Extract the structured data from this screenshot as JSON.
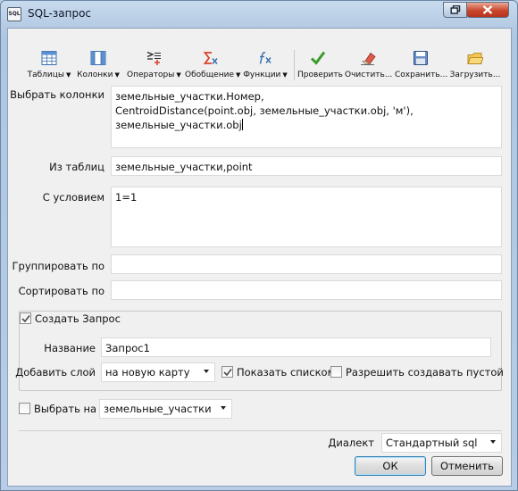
{
  "window": {
    "title": "SQL-запрос",
    "app_icon_text": "SQL"
  },
  "toolbar": {
    "buttons": [
      {
        "label": "Таблицы",
        "arrow": "▼",
        "icon": "table-icon"
      },
      {
        "label": "Колонки",
        "arrow": "▼",
        "icon": "columns-icon"
      },
      {
        "label": "Операторы",
        "arrow": "▼",
        "icon": "operators-icon"
      },
      {
        "label": "Обобщение",
        "arrow": "▼",
        "icon": "sigma-icon"
      },
      {
        "label": "Функции",
        "arrow": "▼",
        "icon": "function-icon"
      },
      {
        "label": "Проверить",
        "arrow": "",
        "icon": "check-icon"
      },
      {
        "label": "Очистить...",
        "arrow": "",
        "icon": "eraser-icon"
      },
      {
        "label": "Сохранить...",
        "arrow": "",
        "icon": "save-icon"
      },
      {
        "label": "Загрузить...",
        "arrow": "",
        "icon": "load-icon"
      }
    ]
  },
  "form": {
    "select_label": "Выбрать колонки",
    "select_lines": [
      "земельные_участки.Номер,",
      "CentroidDistance(point.obj, земельные_участки.obj, 'м'),",
      "земельные_участки.obj"
    ],
    "from_label": "Из таблиц",
    "from_value": "земельные_участки,point",
    "where_label": "С условием",
    "where_value": "1=1",
    "group_label": "Группировать по",
    "group_value": "",
    "order_label": "Сортировать по",
    "order_value": ""
  },
  "create_query": {
    "checkbox_label": "Создать Запрос",
    "checked": true,
    "name_label": "Название",
    "name_value": "Запрос1",
    "add_layer_label": "Добавить слой",
    "add_layer_value": "на новую карту",
    "show_list_label": "Показать списком",
    "show_list_checked": true,
    "allow_empty_label": "Разрешить создавать пустой",
    "allow_empty_checked": false
  },
  "select_on": {
    "checkbox_label": "Выбрать на",
    "checked": false,
    "value": "земельные_участки"
  },
  "dialect": {
    "label": "Диалект",
    "value": "Стандартный sql"
  },
  "buttons": {
    "ok": "ОК",
    "cancel": "Отменить"
  },
  "colors": {
    "accent_blue": "#2a6ebb",
    "check_green": "#3b9a2c",
    "sigma_red": "#d9432b"
  }
}
